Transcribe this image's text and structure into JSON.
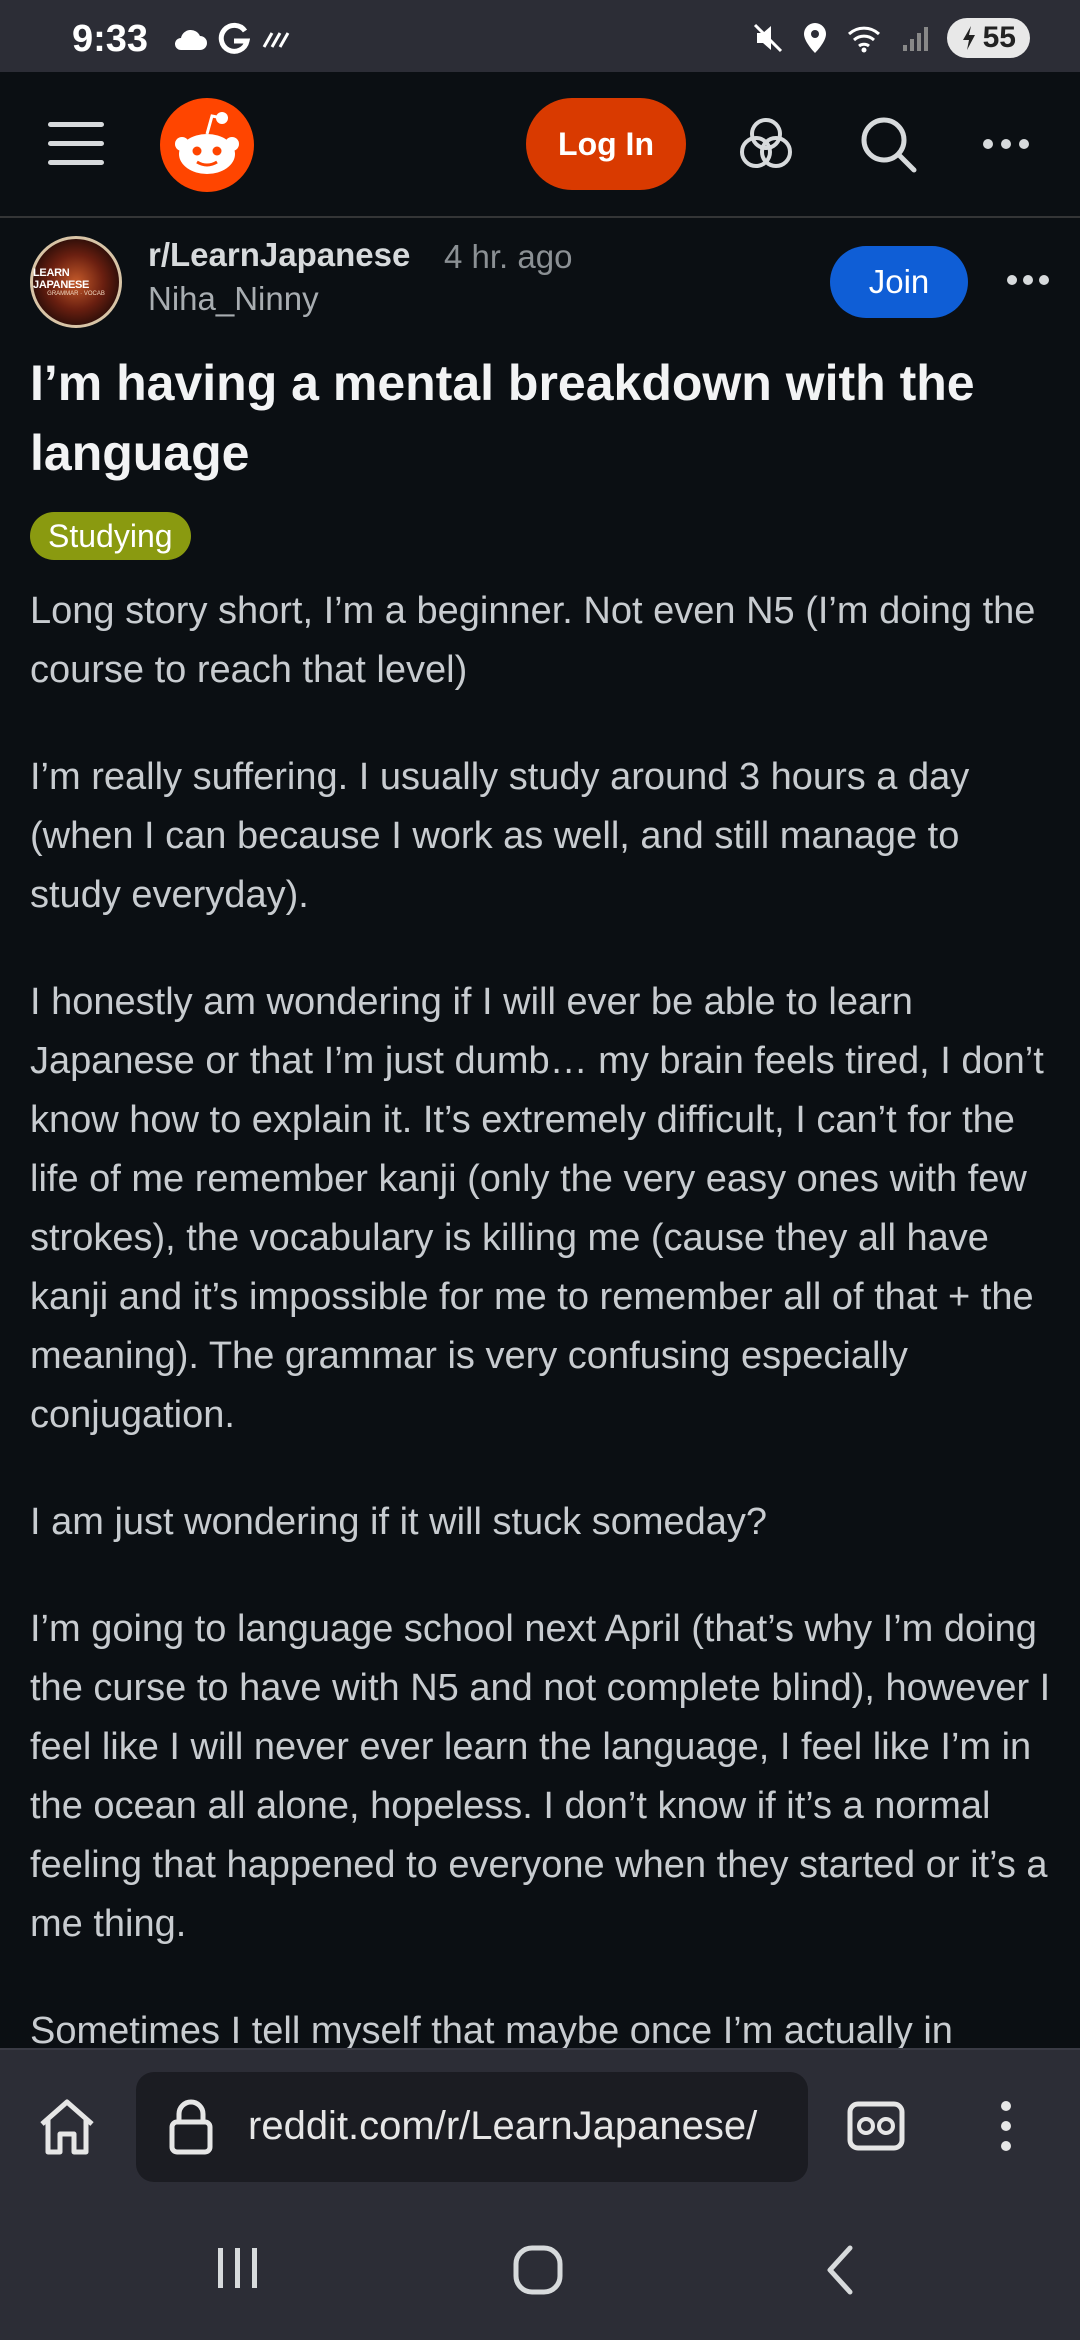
{
  "status_bar": {
    "time": "9:33",
    "battery_level": "55"
  },
  "header": {
    "login_label": "Log In"
  },
  "post": {
    "subreddit": "r/LearnJapanese",
    "age": "4 hr. ago",
    "author": "Niha_Ninny",
    "join_label": "Join",
    "avatar_text_line1": "LEARN JAPANESE",
    "avatar_text_line2": "GRAMMAR · VOCAB",
    "title": "I’m having a mental breakdown with the language",
    "flair": "Studying",
    "paragraphs": [
      "Long story short, I’m a beginner. Not even N5 (I’m doing the course to reach that level)",
      "I’m really suffering. I usually study around 3 hours a day (when I can because I work as well, and still manage to study everyday).",
      "I honestly am wondering if I will ever be able to learn Japanese or that I’m just dumb… my brain feels tired, I don’t know how to explain it. It’s extremely difficult, I can’t for the life of me remember kanji (only the very easy ones with few strokes), the vocabulary is killing me (cause they all have kanji and it’s impossible for me to remember all of that + the meaning). The grammar is very confusing especially conjugation.",
      "I am just wondering if it will stuck someday?",
      "I’m going to language school next April (that’s why I’m doing the curse to have with N5 and not complete blind), however I feel like I will never ever learn the language, I feel like I’m in the ocean all alone, hopeless. I don’t know if it’s a normal feeling that happened to everyone when they started or it’s a me thing.",
      "Sometimes I tell myself that maybe once I’m actually in"
    ]
  },
  "browser": {
    "url": "reddit.com/r/LearnJapanese/"
  },
  "colors": {
    "background": "#0b0f13",
    "reddit_orange": "#ff4500",
    "login_button": "#d93a00",
    "join_button": "#0f5ed6",
    "flair": "#8a9a10",
    "system_bar": "#2c2d36"
  }
}
